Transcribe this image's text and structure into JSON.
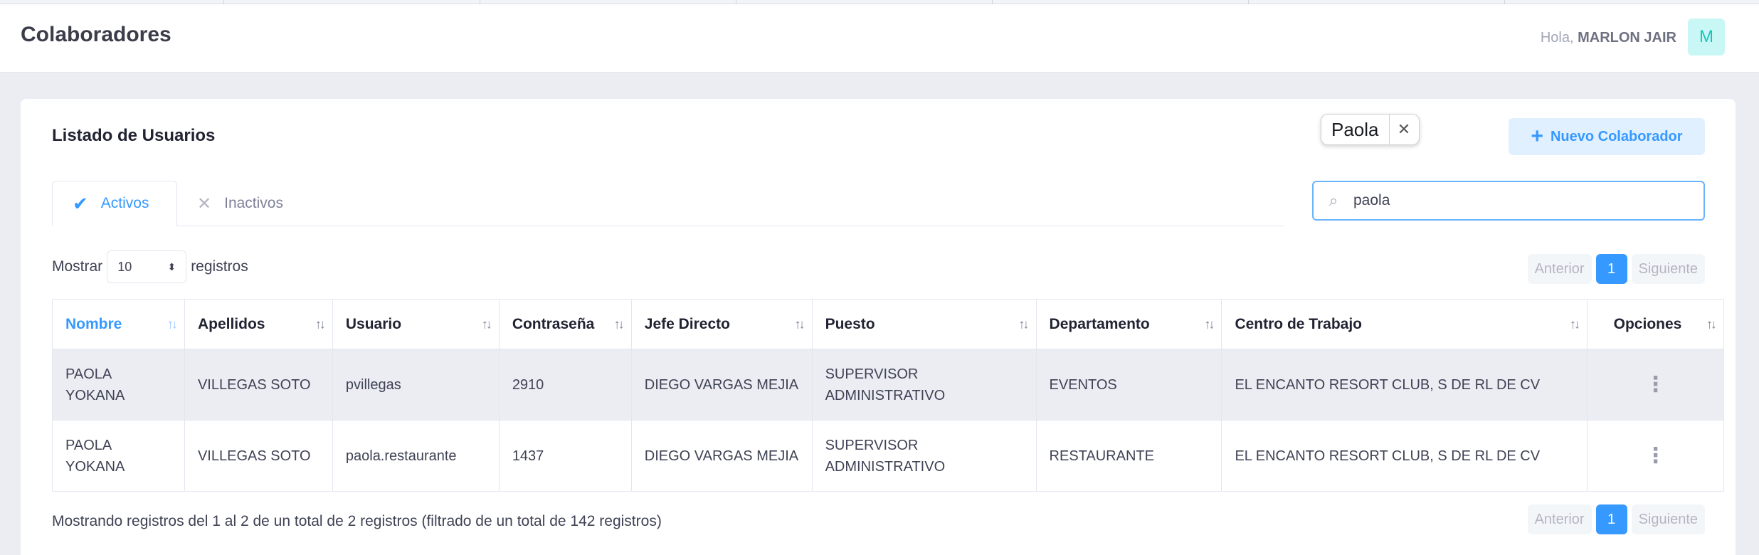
{
  "header": {
    "title": "Colaboradores",
    "greeting_prefix": "Hola,",
    "user_name": "MARLON JAIR",
    "avatar_letter": "M"
  },
  "card": {
    "title": "Listado de Usuarios",
    "new_button_label": "Nuevo Colaborador"
  },
  "tabs": [
    {
      "label": "Activos",
      "active": true,
      "icon": "check-icon"
    },
    {
      "label": "Inactivos",
      "active": false,
      "icon": "close-icon"
    }
  ],
  "search": {
    "value": "paola",
    "suggestion": "Paola"
  },
  "length": {
    "prefix": "Mostrar",
    "value": "10",
    "suffix": "registros"
  },
  "pagination": {
    "prev": "Anterior",
    "current": "1",
    "next": "Siguiente"
  },
  "table": {
    "columns": [
      "Nombre",
      "Apellidos",
      "Usuario",
      "Contraseña",
      "Jefe Directo",
      "Puesto",
      "Departamento",
      "Centro de Trabajo",
      "Opciones"
    ],
    "rows": [
      {
        "nombre": "PAOLA YOKANA",
        "apellidos": "VILLEGAS SOTO",
        "usuario": "pvillegas",
        "contrasena": "2910",
        "jefe": "DIEGO VARGAS MEJIA",
        "puesto": "SUPERVISOR ADMINISTRATIVO",
        "departamento": "EVENTOS",
        "centro": "EL ENCANTO RESORT CLUB, S DE RL DE CV"
      },
      {
        "nombre": "PAOLA YOKANA",
        "apellidos": "VILLEGAS SOTO",
        "usuario": "paola.restaurante",
        "contrasena": "1437",
        "jefe": "DIEGO VARGAS MEJIA",
        "puesto": "SUPERVISOR ADMINISTRATIVO",
        "departamento": "RESTAURANTE",
        "centro": "EL ENCANTO RESORT CLUB, S DE RL DE CV"
      }
    ]
  },
  "info_text": "Mostrando registros del 1 al 2 de un total de 2 registros (filtrado de un total de 142 registros)",
  "colors": {
    "accent": "#3699ff",
    "background": "#ebedf3",
    "avatar_bg": "#c9f7f5",
    "avatar_fg": "#1bc5bd"
  }
}
